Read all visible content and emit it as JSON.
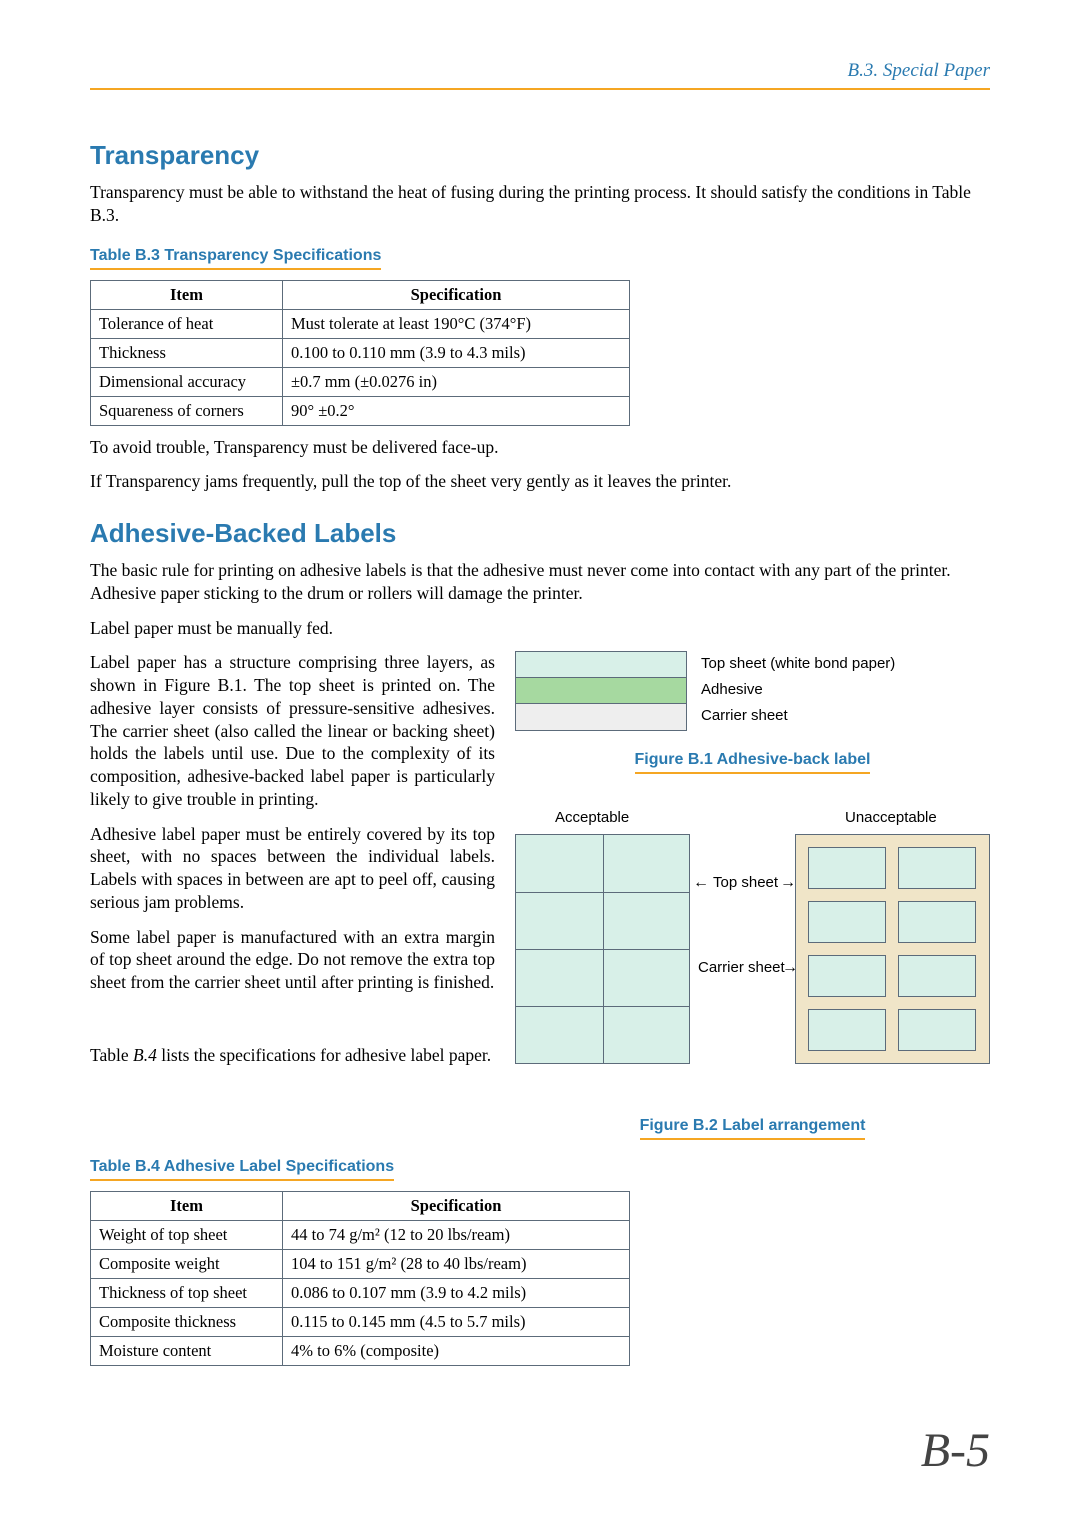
{
  "header": {
    "breadcrumb": "B.3. Special Paper"
  },
  "section1": {
    "title": "Transparency",
    "intro": "Transparency must be able to withstand the heat of fusing during the printing process. It should satisfy the conditions in Table B.3.",
    "table_caption": "Table B.3  Transparency Specifications",
    "table": {
      "head": {
        "c1": "Item",
        "c2": "Specification"
      },
      "rows": [
        {
          "c1": "Tolerance of heat",
          "c2": "Must tolerate at least 190°C (374°F)"
        },
        {
          "c1": "Thickness",
          "c2": "0.100 to 0.110 mm (3.9 to 4.3 mils)"
        },
        {
          "c1": "Dimensional accuracy",
          "c2": "±0.7 mm (±0.0276 in)"
        },
        {
          "c1": "Squareness of corners",
          "c2": "90° ±0.2°"
        }
      ]
    },
    "para2": "To avoid trouble, Transparency must be delivered face-up.",
    "para3": "If Transparency jams frequently, pull the top of the sheet very gently as it leaves the printer."
  },
  "section2": {
    "title": "Adhesive-Backed Labels",
    "p1": "The basic rule for printing on adhesive labels is that the adhesive must never come into contact with any part of the printer. Adhesive paper sticking to the drum or rollers will damage the printer.",
    "p2": "Label paper must be manually fed.",
    "p3": "Label paper has a structure comprising three layers, as shown in Figure B.1. The top sheet is printed on. The adhesive layer consists of pressure-sensitive adhesives. The carrier sheet (also called the linear or backing sheet) holds the labels until use. Due to the complexity of its composition, adhesive-backed label paper is particularly likely to give trouble in printing.",
    "p4": "Adhesive label paper must be entirely covered by its top sheet, with no spaces between the individual labels. Labels with spaces in between are apt to peel off, causing serious jam problems.",
    "p5": "Some label paper is manufactured with an extra margin of top sheet around the edge. Do not remove the extra top sheet from the carrier sheet until after printing is finished.",
    "p6_prefix": "Table ",
    "p6_em": "B.4",
    "p6_suffix": " lists the specifications for adhesive label paper.",
    "fig1": {
      "caption": "Figure B.1 Adhesive-back label",
      "l1": "Top sheet (white bond paper)",
      "l2": "Adhesive",
      "l3": "Carrier sheet"
    },
    "fig2": {
      "caption": "Figure B.2 Label arrangement",
      "acceptable": "Acceptable",
      "unacceptable": "Unacceptable",
      "topsheet": "Top sheet",
      "carrier": "Carrier sheet"
    },
    "table_caption": "Table B.4  Adhesive Label Specifications",
    "table": {
      "head": {
        "c1": "Item",
        "c2": "Specification"
      },
      "rows": [
        {
          "c1": "Weight of top sheet",
          "c2": "44 to 74 g/m² (12 to 20 lbs/ream)"
        },
        {
          "c1": "Composite weight",
          "c2": "104 to 151 g/m² (28 to 40 lbs/ream)"
        },
        {
          "c1": "Thickness of top sheet",
          "c2": "0.086 to 0.107 mm (3.9 to 4.2 mils)"
        },
        {
          "c1": "Composite thickness",
          "c2": "0.115 to 0.145 mm (4.5 to 5.7 mils)"
        },
        {
          "c1": "Moisture content",
          "c2": "4% to 6% (composite)"
        }
      ]
    }
  },
  "page_number": "B-5"
}
